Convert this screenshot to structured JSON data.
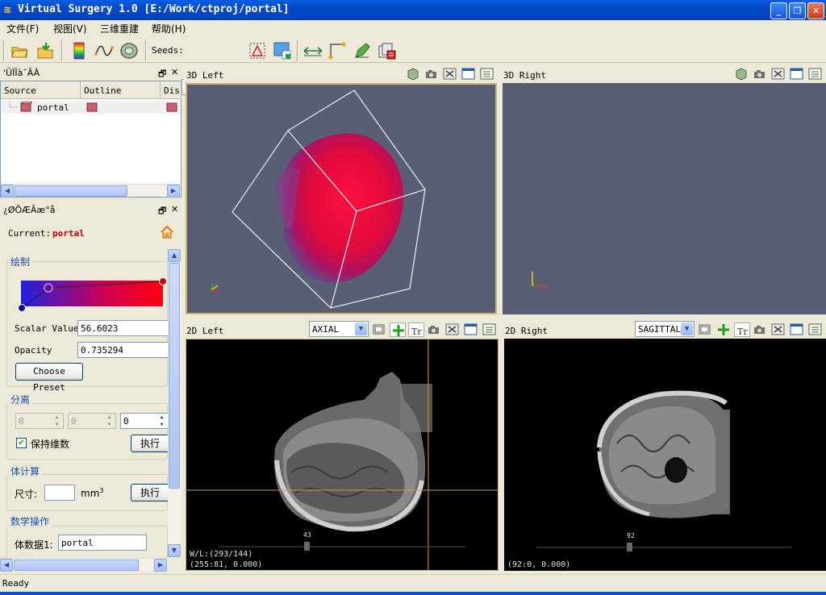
{
  "window": {
    "title": "Virtual Surgery 1.0  [E:/Work/ctproj/portal]",
    "minimize_glyph": "_",
    "maximize_glyph": "❐",
    "close_glyph": "✕"
  },
  "menu": {
    "items": [
      "文件(F)",
      "视图(V)",
      "三维重建",
      "帮助(H)"
    ]
  },
  "toolbar": {
    "seeds_label": "Seeds:",
    "seeds_value": "",
    "icons": [
      "open-folder-icon",
      "import-icon",
      "colormap-icon",
      "curve-icon",
      "ring-icon",
      "select-region-icon",
      "screenshot-region-icon",
      "measure-distance-icon",
      "measure-angle-icon",
      "edit-pen-icon",
      "layers-icon"
    ]
  },
  "source_panel": {
    "title": "'ÜÏÏà¯ÃÀ",
    "columns": [
      "Source",
      "Outline",
      "Dis"
    ],
    "rows": [
      {
        "name": "portal"
      }
    ]
  },
  "props_panel": {
    "title": "¿ØÖÆÃæ°å",
    "current_label": "Current:",
    "current_value": "portal",
    "groups": {
      "draw": {
        "title": "绘制",
        "scalar_label": "Scalar Value",
        "scalar_value": "56.6023",
        "opacity_label": "Opacity",
        "opacity_value": "0.735294",
        "preset_button": "Choose Preset"
      },
      "separate": {
        "title": "分离",
        "spin1": "0",
        "spin2": "0",
        "spin3": "0",
        "keep_dims_label": "保持维数",
        "keep_dims_checked": true,
        "execute": "执行"
      },
      "volume": {
        "title": "体计算",
        "size_label": "尺寸:",
        "size_value": "",
        "unit": "mm",
        "unit_sup": "3",
        "execute": "执行"
      },
      "math": {
        "title": "数学操作",
        "vol1_label": "体数据1:",
        "vol1_value": "portal"
      }
    }
  },
  "views": {
    "left3d": {
      "title": "3D Left"
    },
    "right3d": {
      "title": "3D Right"
    },
    "left2d": {
      "title": "2D Left",
      "orientation": "AXIAL",
      "slice": "43",
      "wl": "W/L:(293/144)",
      "coord": "(255:81, 0.000)"
    },
    "right2d": {
      "title": "2D Right",
      "orientation": "SAGITTAL",
      "slice": "92",
      "coord": "(92:0, 0.000)"
    }
  },
  "status": {
    "text": "Ready"
  },
  "colors": {
    "accent": "#1c50b4",
    "current": "#c00000",
    "crosshair": "#c8a040"
  }
}
